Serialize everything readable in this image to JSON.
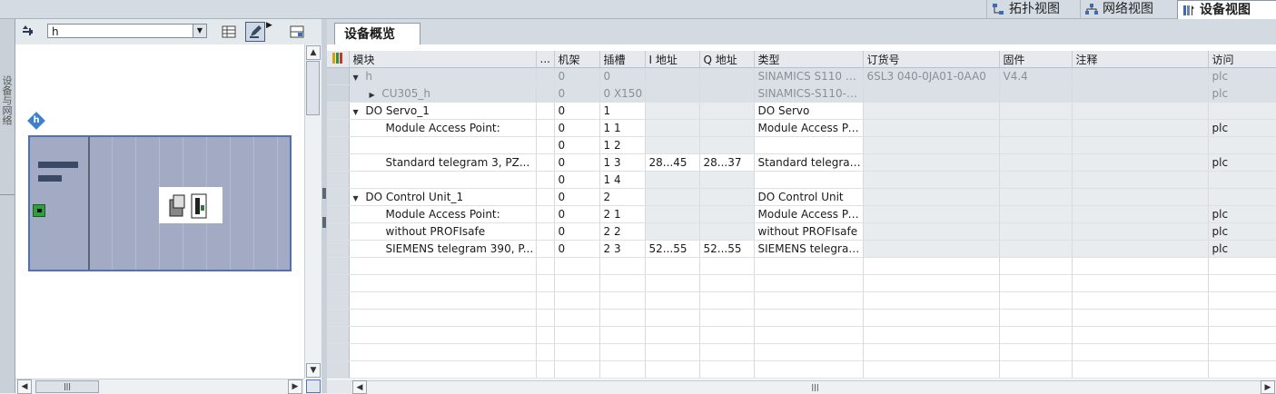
{
  "top_tabs": [
    {
      "label": "拓扑视图"
    },
    {
      "label": "网络视图"
    },
    {
      "label": "设备视图"
    }
  ],
  "side_strip_label": "设备与网络",
  "left_panel": {
    "device_select_value": "h",
    "badge_text": "h"
  },
  "right_tab_label": "设备概览",
  "grid": {
    "headers": [
      "模块",
      "...",
      "机架",
      "插槽",
      "I 地址",
      "Q 地址",
      "类型",
      "订货号",
      "固件",
      "注释",
      "访问"
    ],
    "rows": [
      {
        "toggle": "▼",
        "indent": 0,
        "module": "h",
        "rack": "0",
        "slot": "0",
        "i_addr": "",
        "q_addr": "",
        "type": "SINAMICS S110 CU...",
        "order": "6SL3 040-0JA01-0AA0",
        "fw": "V4.4",
        "comment": "",
        "access": "plc",
        "style": "sel"
      },
      {
        "toggle": "▶",
        "indent": 1,
        "module": "CU305_h",
        "rack": "0",
        "slot": "0 X150",
        "i_addr": "",
        "q_addr": "",
        "type": "SINAMICS-S110-CU...",
        "order": "",
        "fw": "",
        "comment": "",
        "access": "plc",
        "style": "sel"
      },
      {
        "toggle": "▼",
        "indent": 0,
        "module": "DO Servo_1",
        "rack": "0",
        "slot": "1",
        "i_addr": "",
        "q_addr": "",
        "type": "DO Servo",
        "order": "",
        "fw": "",
        "comment": "",
        "access": "",
        "style": ""
      },
      {
        "toggle": "",
        "indent": 2,
        "module": "Module Access Point:",
        "rack": "0",
        "slot": "1 1",
        "i_addr": "",
        "q_addr": "",
        "type": "Module Access Point:",
        "order": "",
        "fw": "",
        "comment": "",
        "access": "plc",
        "style": ""
      },
      {
        "toggle": "",
        "indent": 2,
        "module": "",
        "rack": "0",
        "slot": "1 2",
        "i_addr": "",
        "q_addr": "",
        "type": "",
        "order": "",
        "fw": "",
        "comment": "",
        "access": "",
        "style": ""
      },
      {
        "toggle": "",
        "indent": 2,
        "module": "Standard telegram 3, PZ...",
        "rack": "0",
        "slot": "1 3",
        "i_addr": "28...45",
        "q_addr": "28...37",
        "type": "Standard telegram ...",
        "order": "",
        "fw": "",
        "comment": "",
        "access": "plc",
        "style": "addr"
      },
      {
        "toggle": "",
        "indent": 2,
        "module": "",
        "rack": "0",
        "slot": "1 4",
        "i_addr": "",
        "q_addr": "",
        "type": "",
        "order": "",
        "fw": "",
        "comment": "",
        "access": "",
        "style": ""
      },
      {
        "toggle": "▼",
        "indent": 0,
        "module": "DO Control Unit_1",
        "rack": "0",
        "slot": "2",
        "i_addr": "",
        "q_addr": "",
        "type": "DO Control Unit",
        "order": "",
        "fw": "",
        "comment": "",
        "access": "",
        "style": ""
      },
      {
        "toggle": "",
        "indent": 2,
        "module": "Module Access Point:",
        "rack": "0",
        "slot": "2 1",
        "i_addr": "",
        "q_addr": "",
        "type": "Module Access Point:",
        "order": "",
        "fw": "",
        "comment": "",
        "access": "plc",
        "style": ""
      },
      {
        "toggle": "",
        "indent": 2,
        "module": "without PROFIsafe",
        "rack": "0",
        "slot": "2 2",
        "i_addr": "",
        "q_addr": "",
        "type": "without PROFIsafe",
        "order": "",
        "fw": "",
        "comment": "",
        "access": "plc",
        "style": ""
      },
      {
        "toggle": "",
        "indent": 2,
        "module": "SIEMENS telegram 390, P...",
        "rack": "0",
        "slot": "2 3",
        "i_addr": "52...55",
        "q_addr": "52...55",
        "type": "SIEMENS telegram ...",
        "order": "",
        "fw": "",
        "comment": "",
        "access": "plc",
        "style": "addr"
      }
    ]
  },
  "colors": {
    "rack_fill": "#a3abc4",
    "rack_border": "#4d72b8",
    "status_led": "#2f9e3e",
    "selection_row": "#dbe0e6"
  }
}
